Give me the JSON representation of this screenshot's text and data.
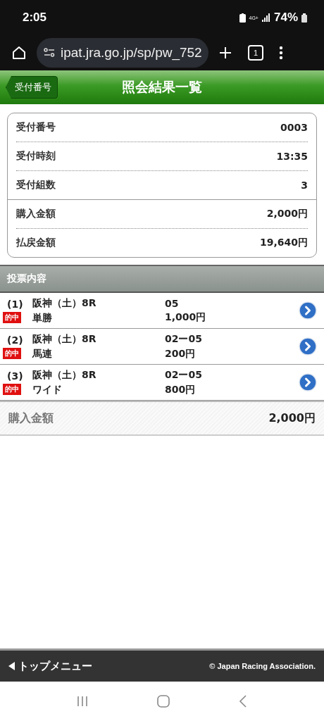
{
  "status_bar": {
    "time": "2:05",
    "network": "4G+",
    "battery": "74%"
  },
  "browser": {
    "url": "ipat.jra.go.jp/sp/pw_752",
    "tab_count": "1"
  },
  "header": {
    "back_button": "受付番号",
    "title": "照会結果一覧"
  },
  "reception": [
    {
      "label": "受付番号",
      "value": "0003"
    },
    {
      "label": "受付時刻",
      "value": "13:35"
    },
    {
      "label": "受付組数",
      "value": "3"
    }
  ],
  "amounts": [
    {
      "label": "購入金額",
      "value": "2,000円"
    },
    {
      "label": "払戻金額",
      "value": "19,640円"
    }
  ],
  "bets_section": {
    "title": "投票内容"
  },
  "bets": [
    {
      "number": "(1)",
      "badge": "的中",
      "race": "阪神（土）8R",
      "bet_type": "単勝",
      "combination": "05",
      "amount": "1,000円"
    },
    {
      "number": "(2)",
      "badge": "的中",
      "race": "阪神（土）8R",
      "bet_type": "馬連",
      "combination": "02ー05",
      "amount": "200円"
    },
    {
      "number": "(3)",
      "badge": "的中",
      "race": "阪神（土）8R",
      "bet_type": "ワイド",
      "combination": "02ー05",
      "amount": "800円"
    }
  ],
  "total": {
    "label": "購入金額",
    "value": "2,000円"
  },
  "footer": {
    "menu_link": "トップメニュー",
    "copyright": "© Japan Racing Association."
  }
}
